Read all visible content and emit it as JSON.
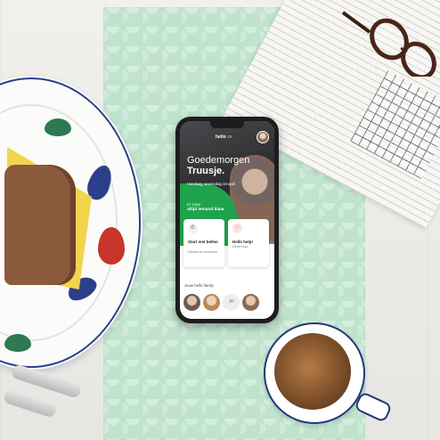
{
  "app": {
    "logo": "hello",
    "logo_suffix": "ze",
    "greeting": "Goedemorgen",
    "name": "Truusje.",
    "date": "Vandaag, woensdag 16 april",
    "ready_line1": "Er staat",
    "ready_line2": "altijd iemand klaar"
  },
  "cards": [
    {
      "title": "Start met bellen",
      "subtitle": "Familie en contacten",
      "icon": "phone-icon"
    },
    {
      "title": "Hello help!",
      "subtitle": "Direct hulp",
      "icon": "alarm-icon"
    }
  ],
  "family": {
    "label": "Jouw hello family",
    "members": [
      {
        "icon": "family-avatar-icon",
        "text": ""
      },
      {
        "icon": "family-avatar-icon",
        "text": ""
      },
      {
        "icon": "initials-avatar",
        "text": "JH"
      },
      {
        "icon": "family-avatar-icon",
        "text": ""
      }
    ]
  },
  "colors": {
    "accent": "#1fa34d",
    "cloth": "#bfe3cc",
    "alert": "#e23c3c"
  }
}
